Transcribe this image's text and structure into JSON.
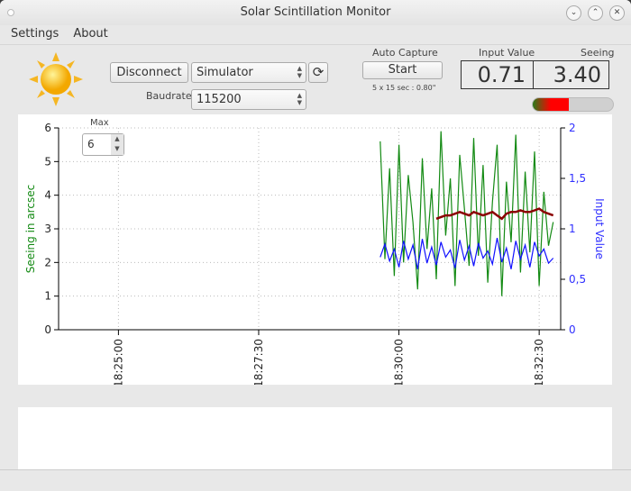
{
  "window": {
    "title": "Solar Scintillation Monitor"
  },
  "menu": {
    "items": [
      "Settings",
      "About"
    ]
  },
  "toolbar": {
    "connect_label": "Disconnect",
    "port": "Simulator",
    "baudrate_label": "Baudrate",
    "baudrate": "115200",
    "auto_capture_label": "Auto Capture",
    "start_label": "Start",
    "capture_info": "5 x 15 sec : 0.80\""
  },
  "readout": {
    "input_label": "Input Value",
    "seeing_label": "Seeing",
    "input_value": "0.71",
    "seeing_value": "3.40",
    "level_percent": 45,
    "level_colors": [
      "#2a7a1a",
      "#ff0000"
    ]
  },
  "max_control": {
    "label": "Max",
    "value": "6"
  },
  "chart_data": {
    "type": "line",
    "ylabel": "Seeing in arcsec",
    "y2label": "Input Value",
    "ylim": [
      0,
      6
    ],
    "y2lim": [
      0,
      2
    ],
    "yticks": [
      "0",
      "1",
      "2",
      "3",
      "4",
      "5",
      "6"
    ],
    "y2ticks": [
      "0",
      "0,5",
      "1",
      "1,5",
      "2"
    ],
    "xlim": [
      "18:23:56",
      "18:32:53"
    ],
    "xticks": [
      "18:25:00",
      "18:27:30",
      "18:30:00",
      "18:32:30"
    ],
    "grid": true,
    "x": [
      "18:29:40",
      "18:29:45",
      "18:29:50",
      "18:29:55",
      "18:30:00",
      "18:30:05",
      "18:30:10",
      "18:30:15",
      "18:30:20",
      "18:30:25",
      "18:30:30",
      "18:30:35",
      "18:30:40",
      "18:30:45",
      "18:30:50",
      "18:30:55",
      "18:31:00",
      "18:31:05",
      "18:31:10",
      "18:31:15",
      "18:31:20",
      "18:31:25",
      "18:31:30",
      "18:31:35",
      "18:31:40",
      "18:31:45",
      "18:31:50",
      "18:31:55",
      "18:32:00",
      "18:32:05",
      "18:32:10",
      "18:32:15",
      "18:32:20",
      "18:32:25",
      "18:32:30",
      "18:32:35",
      "18:32:40",
      "18:32:45"
    ],
    "series": [
      {
        "axis": "left",
        "color": "#138a13",
        "values": [
          5.6,
          2.1,
          4.8,
          1.6,
          5.5,
          2.0,
          4.6,
          3.2,
          1.2,
          5.1,
          2.4,
          4.2,
          1.5,
          5.9,
          2.8,
          4.5,
          1.3,
          5.2,
          3.6,
          1.9,
          5.7,
          2.2,
          4.9,
          1.4,
          3.8,
          5.5,
          1.0,
          4.4,
          2.6,
          5.8,
          1.7,
          4.7,
          2.3,
          5.3,
          1.3,
          4.1,
          2.5,
          3.2
        ]
      },
      {
        "axis": "right",
        "color": "#1010ff",
        "values": [
          0.72,
          0.85,
          0.68,
          0.8,
          0.62,
          0.88,
          0.7,
          0.84,
          0.6,
          0.9,
          0.66,
          0.82,
          0.64,
          0.87,
          0.72,
          0.79,
          0.61,
          0.89,
          0.69,
          0.83,
          0.63,
          0.86,
          0.71,
          0.78,
          0.65,
          0.91,
          0.67,
          0.81,
          0.6,
          0.88,
          0.7,
          0.84,
          0.62,
          0.87,
          0.73,
          0.8,
          0.66,
          0.71
        ]
      },
      {
        "axis": "left",
        "color": "#8b0000",
        "values": [
          null,
          null,
          null,
          null,
          null,
          null,
          null,
          null,
          null,
          null,
          null,
          null,
          3.3,
          3.35,
          3.4,
          3.4,
          3.45,
          3.5,
          3.45,
          3.4,
          3.5,
          3.45,
          3.4,
          3.45,
          3.5,
          3.4,
          3.3,
          3.45,
          3.5,
          3.5,
          3.55,
          3.5,
          3.5,
          3.55,
          3.6,
          3.5,
          3.45,
          3.4
        ]
      }
    ]
  }
}
